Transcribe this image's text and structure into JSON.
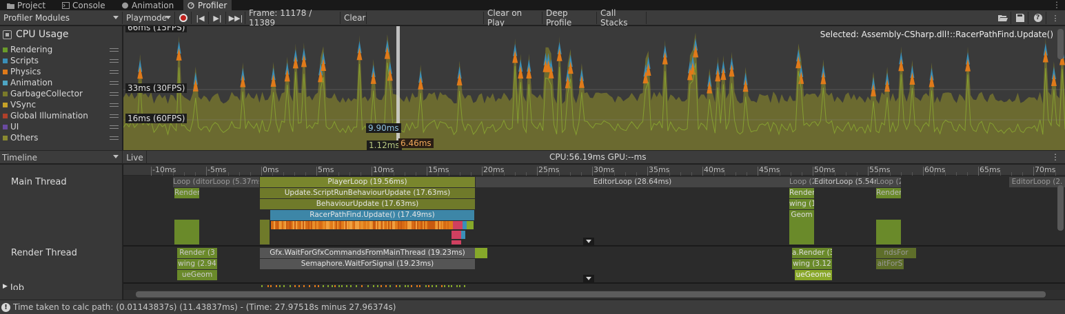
{
  "tabs": [
    {
      "label": "Project",
      "icon": "folder-icon"
    },
    {
      "label": "Console",
      "icon": "console-icon"
    },
    {
      "label": "Animation",
      "icon": "animation-icon"
    },
    {
      "label": "Profiler",
      "icon": "profiler-icon",
      "active": true
    }
  ],
  "toolbar": {
    "modules_label": "Profiler Modules",
    "target_label": "Playmode",
    "frame_label": "Frame: 11178 / 11389",
    "clear_label": "Clear",
    "clear_on_play_label": "Clear on Play",
    "deep_profile_label": "Deep Profile",
    "call_stacks_label": "Call Stacks"
  },
  "cpu": {
    "title": "CPU Usage",
    "legend": [
      {
        "label": "Rendering",
        "color": "#6a9a2a"
      },
      {
        "label": "Scripts",
        "color": "#3a8fb8"
      },
      {
        "label": "Physics",
        "color": "#e07a1a"
      },
      {
        "label": "Animation",
        "color": "#4ea6c4"
      },
      {
        "label": "GarbageCollector",
        "color": "#7a7a2a"
      },
      {
        "label": "VSync",
        "color": "#c6a228"
      },
      {
        "label": "Global Illumination",
        "color": "#b0402a"
      },
      {
        "label": "UI",
        "color": "#6a4aa0"
      },
      {
        "label": "Others",
        "color": "#8a8a30"
      }
    ],
    "selected_label": "Selected: Assembly-CSharp.dll!::RacerPathFind.Update()",
    "markers": {
      "fps15": "66ms (15FPS)",
      "fps30": "33ms (30FPS)",
      "fps60": "16ms (60FPS)",
      "sel_a": "9.90ms",
      "sel_b": "1.12ms",
      "sel_c": "6.46ms"
    }
  },
  "timeline": {
    "view_label": "Timeline",
    "live_label": "Live",
    "cpu_gpu": "CPU:56.19ms   GPU:--ms",
    "ticks": [
      "-10ms",
      "-5ms",
      "0ms",
      "5ms",
      "10ms",
      "15ms",
      "20ms",
      "25ms",
      "30ms",
      "35ms",
      "40ms",
      "45ms",
      "50ms",
      "55ms",
      "60ms",
      "65ms",
      "70ms"
    ],
    "threads": {
      "main": "Main Thread",
      "render": "Render Thread",
      "job": "Job"
    },
    "main_samples": {
      "prev_loop": "Loop (2.",
      "prev_editor": "ditorLoop (5.37ms",
      "player_loop": "PlayerLoop (19.56ms)",
      "editor_loop": "EditorLoop (28.64ms)",
      "next_loop": "Loop (2.",
      "next_editor": "EditorLoop (5.54ms)",
      "far_loop": "Loop (2.",
      "far_editor": "EditorLoop (2.",
      "update_srb": "Update.ScriptRunBehaviourUpdate (17.63ms)",
      "behaviour_update": "BehaviourUpdate (17.63ms)",
      "racer_update": "RacerPathFind.Update() (17.49ms)",
      "prev_render": "Render",
      "next_render": "Render",
      "next_wing": "wing (1.",
      "next_geom": "Geom",
      "far_render": "Render"
    },
    "render_samples": {
      "prev_render": "Render (3",
      "prev_wing": "wing (2.94",
      "prev_geom": "ueGeom",
      "gfx_wait": "Gfx.WaitForGfxCommandsFromMainThread (19.23ms)",
      "semaphore": "Semaphore.WaitForSignal (19.23ms)",
      "next_render": "a.Render (3",
      "next_wing": "wing (3.12",
      "next_geom": "ueGeome",
      "far_render": "ndsFor",
      "far_wing": "aitForS"
    }
  },
  "status": {
    "icon": "info-icon",
    "message": "Time taken to calc path: (0.01143837s)  (11.43837ms) - (Time: 27.97518s minus 27.96374s)"
  }
}
